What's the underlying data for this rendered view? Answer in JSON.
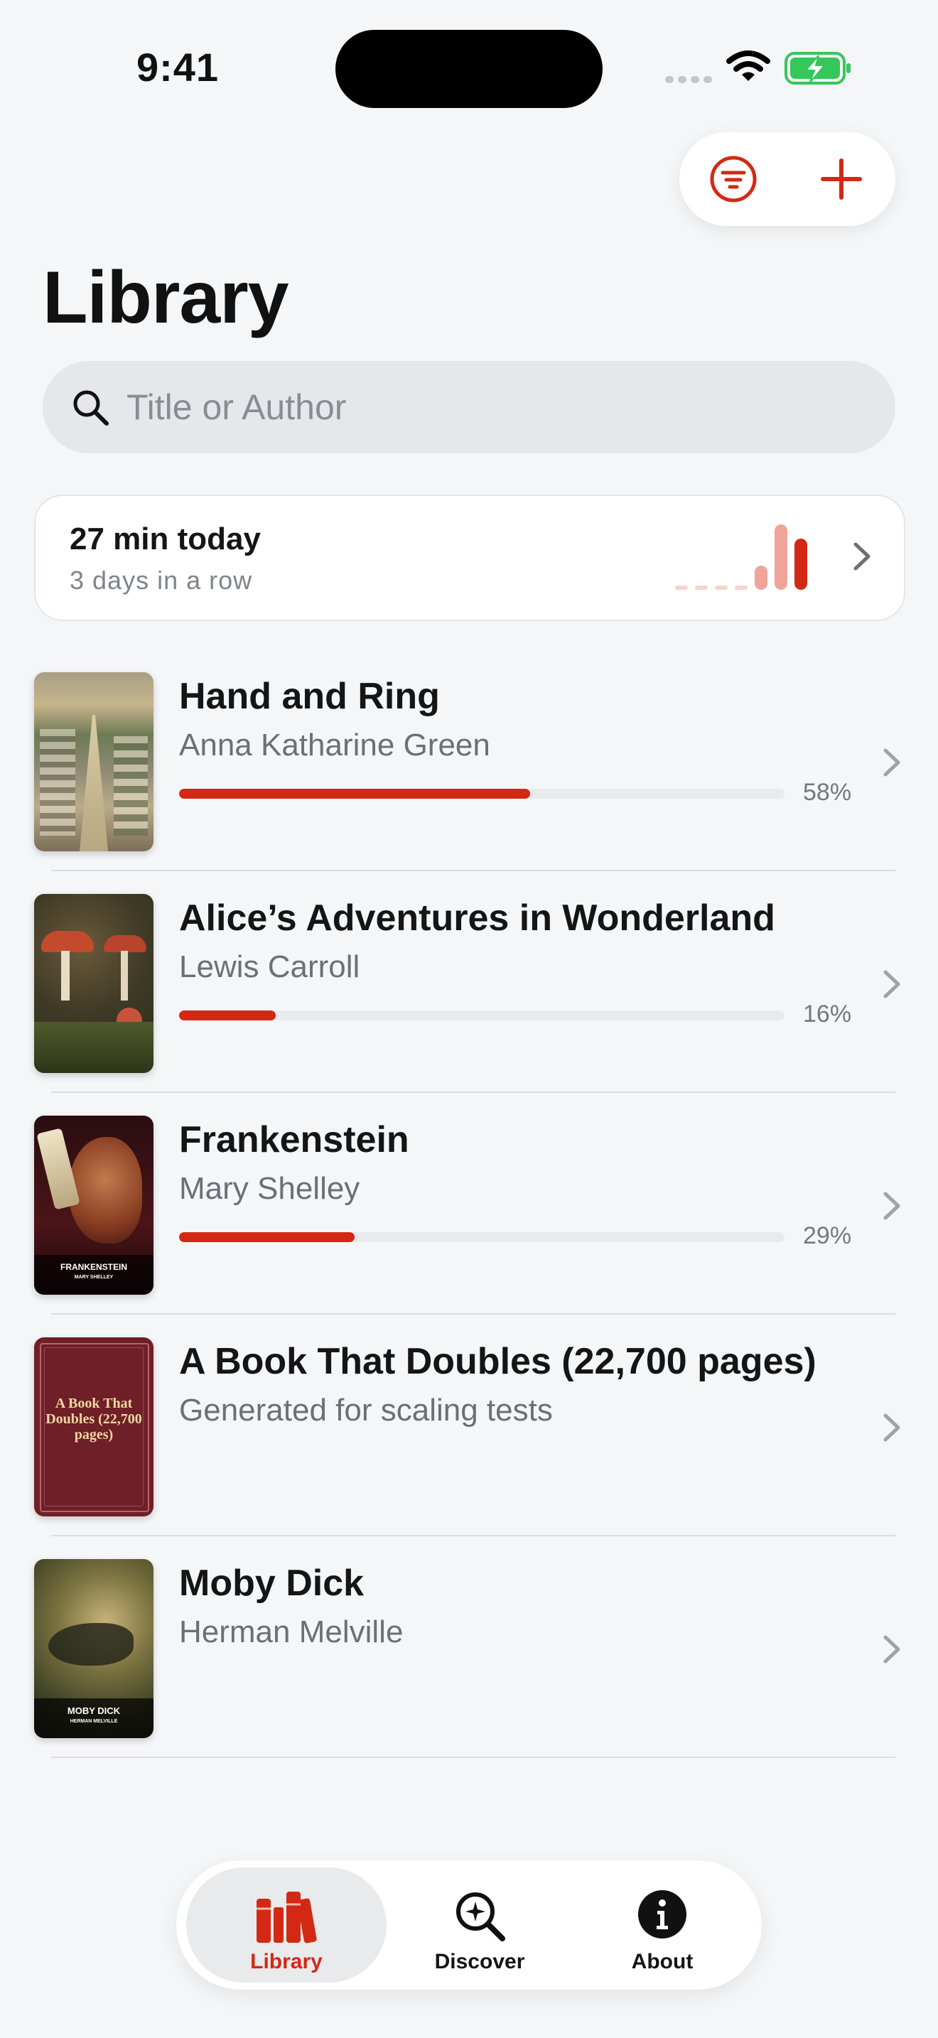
{
  "status_bar": {
    "time": "9:41"
  },
  "header": {
    "title": "Library"
  },
  "search": {
    "placeholder": "Title or Author"
  },
  "reading_stats": {
    "today": "27 min today",
    "streak": "3 days in a row"
  },
  "books": [
    {
      "title": "Hand and Ring",
      "author": "Anna Katharine Green",
      "progress_label": "58%",
      "progress": 0.58
    },
    {
      "title": "Alice’s Adventures in Wonderland",
      "author": "Lewis Carroll",
      "progress_label": "16%",
      "progress": 0.16
    },
    {
      "title": "Frankenstein",
      "author": "Mary Shelley",
      "progress_label": "29%",
      "progress": 0.29,
      "cover_title": "FRANKENSTEIN",
      "cover_author": "MARY SHELLEY"
    },
    {
      "title": "A Book That Doubles (22,700 pages)",
      "author": "Generated for scaling tests",
      "cover_title": "A Book That Doubles (22,700 pages)"
    },
    {
      "title": "Moby Dick",
      "author": "Herman Melville",
      "cover_title": "MOBY DICK",
      "cover_author": "HERMAN MELVILLE"
    }
  ],
  "tabs": [
    {
      "label": "Library",
      "icon": "books-icon",
      "active": true
    },
    {
      "label": "Discover",
      "icon": "discover-icon",
      "active": false
    },
    {
      "label": "About",
      "icon": "info-icon",
      "active": false
    }
  ],
  "colors": {
    "accent": "#d32914",
    "background": "#f5f6f8"
  }
}
